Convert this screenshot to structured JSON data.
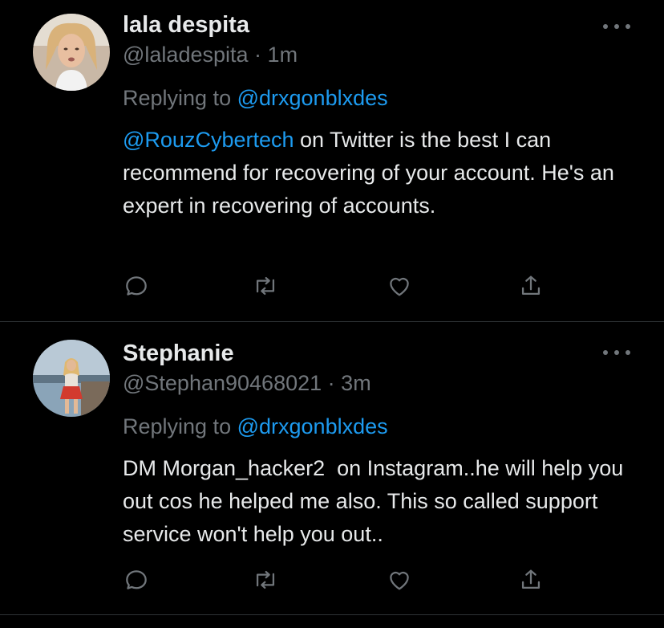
{
  "tweets": [
    {
      "display_name": "lala despita",
      "handle": "@laladespita",
      "separator": "·",
      "time": "1m",
      "replying_prefix": "Replying to",
      "replying_to": "@drxgonblxdes",
      "mention": "@RouzCybertech",
      "text_rest": " on Twitter is the best I can recommend for recovering of your account. He's an expert in recovering of accounts.",
      "avatar_icon": "person-avatar"
    },
    {
      "display_name": "Stephanie",
      "handle": "@Stephan90468021",
      "separator": "·",
      "time": "3m",
      "replying_prefix": "Replying to",
      "replying_to": "@drxgonblxdes",
      "text": "DM Morgan_hacker2  on Instagram..he will help you out cos he helped me also. This so called support service won't help you out..",
      "avatar_icon": "person-avatar"
    }
  ],
  "icons": {
    "reply": "reply-icon",
    "retweet": "retweet-icon",
    "like": "heart-icon",
    "share": "share-icon",
    "more": "more-options-icon"
  },
  "colors": {
    "background": "#000000",
    "text": "#e7e9ea",
    "secondary": "#71767b",
    "accent": "#1d9bf0",
    "divider": "#2f3336"
  }
}
